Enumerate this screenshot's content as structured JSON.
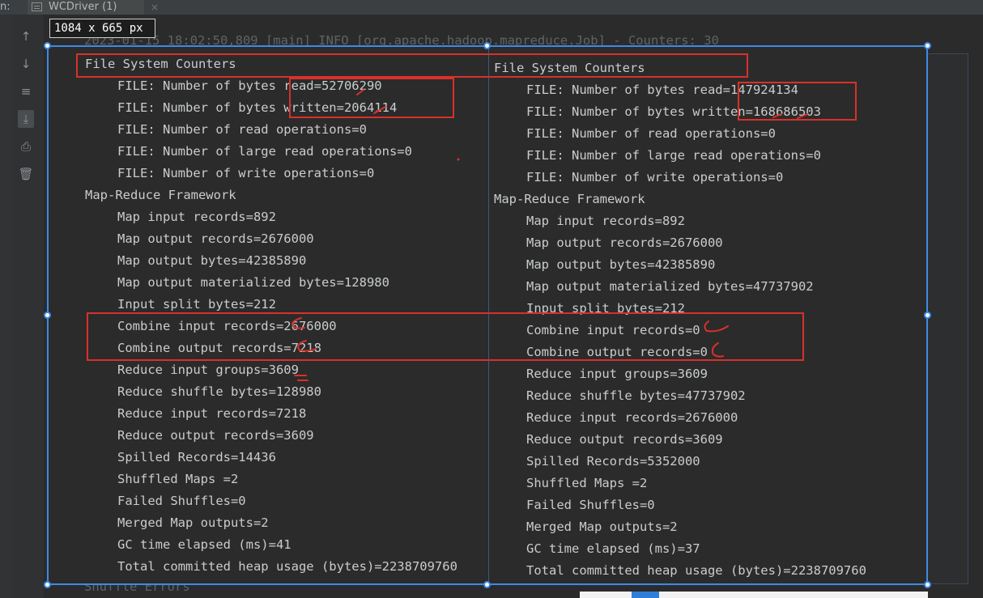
{
  "tab": {
    "prefix": "n:",
    "title": "WCDriver (1)",
    "close": "×"
  },
  "toolbar": {
    "items": [
      {
        "name": "scroll-up-icon",
        "glyph": "↑"
      },
      {
        "name": "scroll-down-icon",
        "glyph": "↓"
      },
      {
        "name": "soft-wrap-icon",
        "glyph": "≡"
      },
      {
        "name": "scroll-to-end-icon",
        "glyph": "⤓"
      },
      {
        "name": "print-icon",
        "glyph": "⎙"
      },
      {
        "name": "trash-icon",
        "glyph": "🗑"
      }
    ]
  },
  "snip": {
    "size_label": "1084 x 665  px"
  },
  "background_console": {
    "top_line": "2023-01-15 18:02:50,809 [main] INFO [org.apache.hadoop.mapreduce.Job] - Counters: 30",
    "bottom_line": "Shuffle Errors"
  },
  "left_column": {
    "lines": [
      {
        "text": "File System Counters",
        "indent": false
      },
      {
        "text": "FILE: Number of bytes read=52706290",
        "indent": true
      },
      {
        "text": "FILE: Number of bytes written=2064114",
        "indent": true
      },
      {
        "text": "FILE: Number of read operations=0",
        "indent": true
      },
      {
        "text": "FILE: Number of large read operations=0",
        "indent": true
      },
      {
        "text": "FILE: Number of write operations=0",
        "indent": true
      },
      {
        "text": "Map-Reduce Framework",
        "indent": false
      },
      {
        "text": "Map input records=892",
        "indent": true
      },
      {
        "text": "Map output records=2676000",
        "indent": true
      },
      {
        "text": "Map output bytes=42385890",
        "indent": true
      },
      {
        "text": "Map output materialized bytes=128980",
        "indent": true
      },
      {
        "text": "Input split bytes=212",
        "indent": true
      },
      {
        "text": "Combine input records=2676000",
        "indent": true
      },
      {
        "text": "Combine output records=7218",
        "indent": true
      },
      {
        "text": "Reduce input groups=3609",
        "indent": true
      },
      {
        "text": "Reduce shuffle bytes=128980",
        "indent": true
      },
      {
        "text": "Reduce input records=7218",
        "indent": true
      },
      {
        "text": "Reduce output records=3609",
        "indent": true
      },
      {
        "text": "Spilled Records=14436",
        "indent": true
      },
      {
        "text": "Shuffled Maps =2",
        "indent": true
      },
      {
        "text": "Failed Shuffles=0",
        "indent": true
      },
      {
        "text": "Merged Map outputs=2",
        "indent": true
      },
      {
        "text": "GC time elapsed (ms)=41",
        "indent": true
      },
      {
        "text": "Total committed heap usage (bytes)=2238709760",
        "indent": true
      }
    ]
  },
  "right_column": {
    "lines": [
      {
        "text": "File System Counters",
        "indent": false
      },
      {
        "text": "FILE: Number of bytes read=147924134",
        "indent": true
      },
      {
        "text": "FILE: Number of bytes written=168686503",
        "indent": true
      },
      {
        "text": "FILE: Number of read operations=0",
        "indent": true
      },
      {
        "text": "FILE: Number of large read operations=0",
        "indent": true
      },
      {
        "text": "FILE: Number of write operations=0",
        "indent": true
      },
      {
        "text": "Map-Reduce Framework",
        "indent": false
      },
      {
        "text": "Map input records=892",
        "indent": true
      },
      {
        "text": "Map output records=2676000",
        "indent": true
      },
      {
        "text": "Map output bytes=42385890",
        "indent": true
      },
      {
        "text": "Map output materialized bytes=47737902",
        "indent": true
      },
      {
        "text": "Input split bytes=212",
        "indent": true
      },
      {
        "text": "Combine input records=0",
        "indent": true
      },
      {
        "text": "Combine output records=0",
        "indent": true
      },
      {
        "text": "Reduce input groups=3609",
        "indent": true
      },
      {
        "text": "Reduce shuffle bytes=47737902",
        "indent": true
      },
      {
        "text": "Reduce input records=2676000",
        "indent": true
      },
      {
        "text": "Reduce output records=3609",
        "indent": true
      },
      {
        "text": "Spilled Records=5352000",
        "indent": true
      },
      {
        "text": "Shuffled Maps =2",
        "indent": true
      },
      {
        "text": "Failed Shuffles=0",
        "indent": true
      },
      {
        "text": "Merged Map outputs=2",
        "indent": true
      },
      {
        "text": "GC time elapsed (ms)=37",
        "indent": true
      },
      {
        "text": "Total committed heap usage (bytes)=2238709760",
        "indent": true
      }
    ]
  },
  "colors": {
    "annotation_red": "#d8312b",
    "selection_blue": "#3d8ae6",
    "console_text": "#c9ccce"
  }
}
